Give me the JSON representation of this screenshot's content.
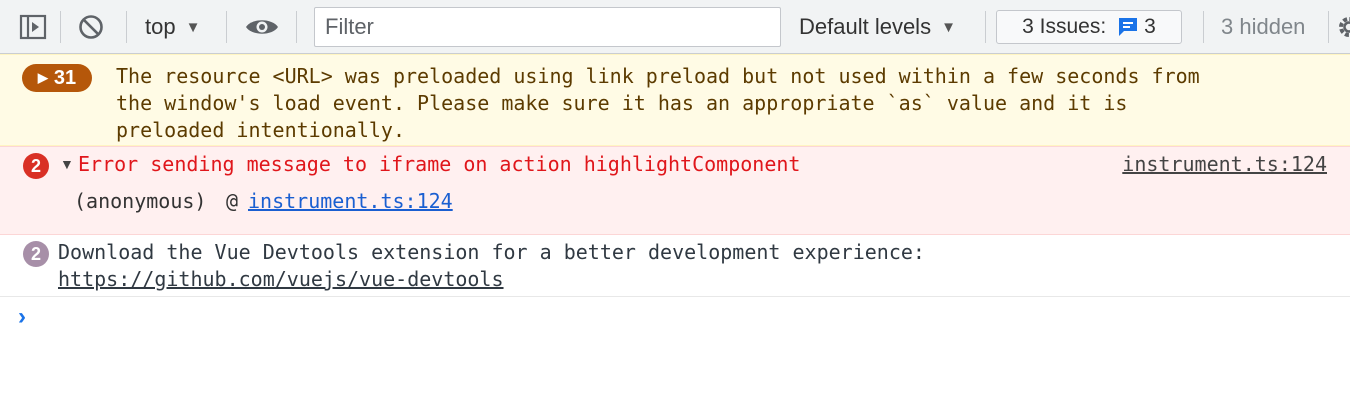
{
  "toolbar": {
    "context": "top",
    "filter_placeholder": "Filter",
    "levels": "Default levels",
    "issues_label": "3 Issues:",
    "issues_count": "3",
    "hidden": "3 hidden"
  },
  "messages": {
    "warning": {
      "count": "31",
      "text": "The resource <URL> was preloaded using link preload but not used within a few seconds from\nthe window's load event. Please make sure it has an appropriate `as` value and it is\npreloaded intentionally."
    },
    "error": {
      "count": "2",
      "text": "Error sending message to iframe on action highlightComponent",
      "source": "instrument.ts:124",
      "stack_fn": "(anonymous)",
      "stack_at": "@",
      "stack_link": "instrument.ts:124"
    },
    "info": {
      "count": "2",
      "text": "Download the Vue Devtools extension for a better development experience:",
      "link": "https://github.com/vuejs/vue-devtools"
    }
  },
  "colors": {
    "warning_bg": "#fffbe5",
    "error_bg": "#fff0f0",
    "error_text": "#e0161b",
    "link": "#1a5fd1",
    "prompt": "#1a73e8"
  }
}
